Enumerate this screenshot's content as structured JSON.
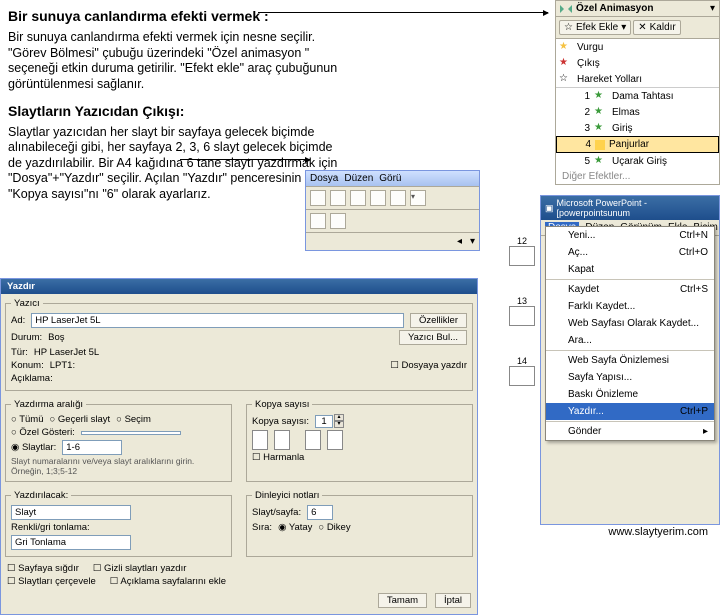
{
  "text": {
    "h1": "Bir sunuya canlandırma efekti vermek :",
    "p1": "Bir sunuya canlandırma efekti vermek için nesne seçilir. \"Görev Bölmesi\" çubuğu üzerindeki \"Özel animasyon \" seçeneği etkin duruma getirilir. \"Efekt ekle\" araç çubuğunun görüntülenmesi sağlanır.",
    "h2": "Slaytların Yazıcıdan Çıkışı:",
    "p2": "Slaytlar yazıcıdan her slayt bir sayfaya gelecek biçimde alınabileceği gibi, her sayfaya 2, 3, 6 slayt gelecek biçimde de yazdırılabilir. Bir A4 kağıdına 6 tane slaytı yazdırmak için \"Dosya\"+\"Yazdır\" seçilir. Açılan \"Yazdır\" penceresinin \"Kopya sayısı\"nı \"6\" olarak ayarlarız."
  },
  "anim_pane": {
    "title": "Özel Animasyon",
    "btn_add": "Efek Ekle",
    "btn_remove": "Kaldır",
    "items": [
      {
        "label": "Vurgu"
      },
      {
        "label": "Çıkış"
      },
      {
        "label": "Hareket Yolları"
      }
    ],
    "sub": [
      {
        "n": "1",
        "label": "Dama Tahtası"
      },
      {
        "n": "2",
        "label": "Elmas"
      },
      {
        "n": "3",
        "label": "Giriş"
      },
      {
        "n": "4",
        "label": "Panjurlar"
      },
      {
        "n": "5",
        "label": "Uçarak Giriş"
      }
    ],
    "more": "Diğer Efektler..."
  },
  "mini_tb": {
    "menus": [
      "Dosya",
      "Düzen",
      "Görü"
    ]
  },
  "pp": {
    "title": "Microsoft PowerPoint - [powerpointsunum",
    "menubar": [
      "Dosya",
      "Düzen",
      "Görünüm",
      "Ekle",
      "Biçim"
    ],
    "thumbs": [
      "12",
      "13",
      "14"
    ],
    "file_menu": [
      {
        "label": "Yeni...",
        "sc": "Ctrl+N"
      },
      {
        "label": "Aç...",
        "sc": "Ctrl+O"
      },
      {
        "label": "Kapat",
        "sc": ""
      },
      {
        "label": "Kaydet",
        "sc": "Ctrl+S"
      },
      {
        "label": "Farklı Kaydet...",
        "sc": ""
      },
      {
        "label": "Web Sayfası Olarak Kaydet...",
        "sc": ""
      },
      {
        "label": "Ara...",
        "sc": ""
      },
      {
        "label": "Web Sayfa Önizlemesi",
        "sc": ""
      },
      {
        "label": "Sayfa Yapısı...",
        "sc": ""
      },
      {
        "label": "Baskı Önizleme",
        "sc": ""
      },
      {
        "label": "Yazdır...",
        "sc": "Ctrl+P"
      },
      {
        "label": "Gönder",
        "sc": ""
      }
    ]
  },
  "print": {
    "title": "Yazdır",
    "grp_printer": "Yazıcı",
    "lbl_name": "Ad:",
    "val_name": "HP LaserJet 5L",
    "lbl_status": "Durum:",
    "val_status": "Boş",
    "lbl_type": "Tür:",
    "val_type": "HP LaserJet 5L",
    "lbl_where": "Konum:",
    "val_where": "LPT1:",
    "lbl_comment": "Açıklama:",
    "btn_props": "Özellikler",
    "btn_find": "Yazıcı Bul...",
    "chk_tofile": "Dosyaya yazdır",
    "grp_range": "Yazdırma aralığı",
    "r_all": "Tümü",
    "r_current": "Geçerli slayt",
    "r_selection": "Seçim",
    "r_custom": "Özel Gösteri:",
    "r_slides": "Slaytlar:",
    "val_slides": "1-6",
    "range_hint": "Slayt numaralarını ve/veya slayt aralıklarını girin. Örneğin, 1;3;5-12",
    "grp_copies": "Kopya sayısı",
    "lbl_copies": "Kopya sayısı:",
    "val_copies": "1",
    "chk_collate": "Harmanla",
    "grp_printwhat": "Yazdırılacak:",
    "val_printwhat": "Slayt",
    "lbl_colormode": "Renkli/gri tonlama:",
    "val_colormode": "Gri Tonlama",
    "grp_handout": "Dinleyici notları",
    "lbl_perpage": "Slayt/sayfa:",
    "val_perpage": "6",
    "lbl_order": "Sıra:",
    "order_h": "Yatay",
    "order_v": "Dikey",
    "chk_frame": "Sayfaya sığdır",
    "chk_hidden": "Gizli slaytları yazdır",
    "chk_border": "Slaytları çerçevele",
    "chk_comments": "Açıklama sayfalarını ekle",
    "btn_ok": "Tamam",
    "btn_cancel": "İptal"
  },
  "footer": "www.slaytyerim.com"
}
